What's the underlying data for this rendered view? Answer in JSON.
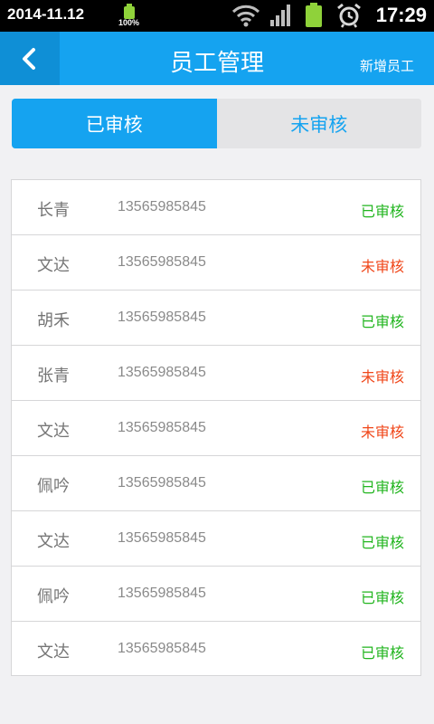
{
  "status_bar": {
    "date": "2014-11.12",
    "battery_small_percent": "100%",
    "time": "17:29",
    "icons": [
      "wifi-icon",
      "signal-icon",
      "battery-icon",
      "alarm-clock-icon"
    ]
  },
  "app_bar": {
    "back_icon": "chevron-left-icon",
    "title": "员工管理",
    "action_label": "新增员工"
  },
  "tabs": [
    {
      "label": "已审核",
      "active": true
    },
    {
      "label": "未审核",
      "active": false
    }
  ],
  "colors": {
    "accent": "#15a3f0",
    "approved": "#22b51f",
    "pending": "#f0471a"
  },
  "employees": [
    {
      "name": "长青",
      "phone": "13565985845",
      "status": "已审核",
      "approved": true
    },
    {
      "name": "文达",
      "phone": "13565985845",
      "status": "未审核",
      "approved": false
    },
    {
      "name": "胡禾",
      "phone": "13565985845",
      "status": "已审核",
      "approved": true
    },
    {
      "name": "张青",
      "phone": "13565985845",
      "status": "未审核",
      "approved": false
    },
    {
      "name": "文达",
      "phone": "13565985845",
      "status": "未审核",
      "approved": false
    },
    {
      "name": "佩吟",
      "phone": "13565985845",
      "status": "已审核",
      "approved": true
    },
    {
      "name": "文达",
      "phone": "13565985845",
      "status": "已审核",
      "approved": true
    },
    {
      "name": "佩吟",
      "phone": "13565985845",
      "status": "已审核",
      "approved": true
    },
    {
      "name": "文达",
      "phone": "13565985845",
      "status": "已审核",
      "approved": true
    }
  ]
}
